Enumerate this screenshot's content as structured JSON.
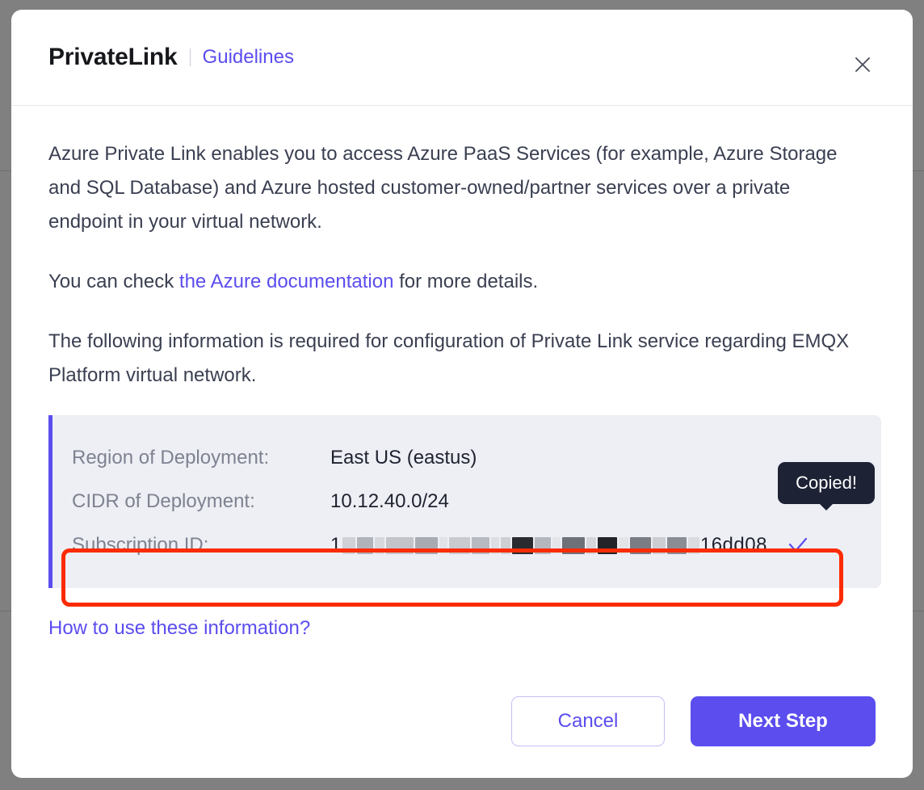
{
  "modal": {
    "title": "PrivateLink",
    "guidelines_label": "Guidelines",
    "close_icon": "close-icon"
  },
  "body": {
    "paragraph_1": "Azure Private Link enables you to access Azure PaaS Services (for example, Azure Storage and SQL Database) and Azure hosted customer-owned/partner services over a private endpoint in your virtual network.",
    "paragraph_2_prefix": "You can check ",
    "paragraph_2_link": "the Azure documentation",
    "paragraph_2_suffix": " for more details.",
    "paragraph_3": "The following information is required for configuration of Private Link service regarding EMQX Platform virtual network."
  },
  "info_box": {
    "rows": [
      {
        "label": "Region of Deployment:",
        "value": "East US (eastus)"
      },
      {
        "label": "CIDR of Deployment:",
        "value": "10.12.40.0/24"
      },
      {
        "label": "Subscription ID:",
        "value": "1•••••••••-••••-••••-••••-••••••16dd08"
      }
    ],
    "subscription_id_visible_prefix": "1",
    "subscription_id_visible_suffix": "16dd08",
    "copy_check_icon": "check-icon",
    "accent_color": "#5b4dee",
    "background_color": "#edeff4"
  },
  "tooltip": {
    "text": "Copied!",
    "background_color": "#1e2235"
  },
  "annotation": {
    "highlight_color": "#fb2b00",
    "target": "subscription-id-row"
  },
  "links": {
    "how_to_use": "How to use these information?"
  },
  "footer": {
    "cancel_label": "Cancel",
    "next_label": "Next Step",
    "primary_color": "#5b4dee"
  }
}
